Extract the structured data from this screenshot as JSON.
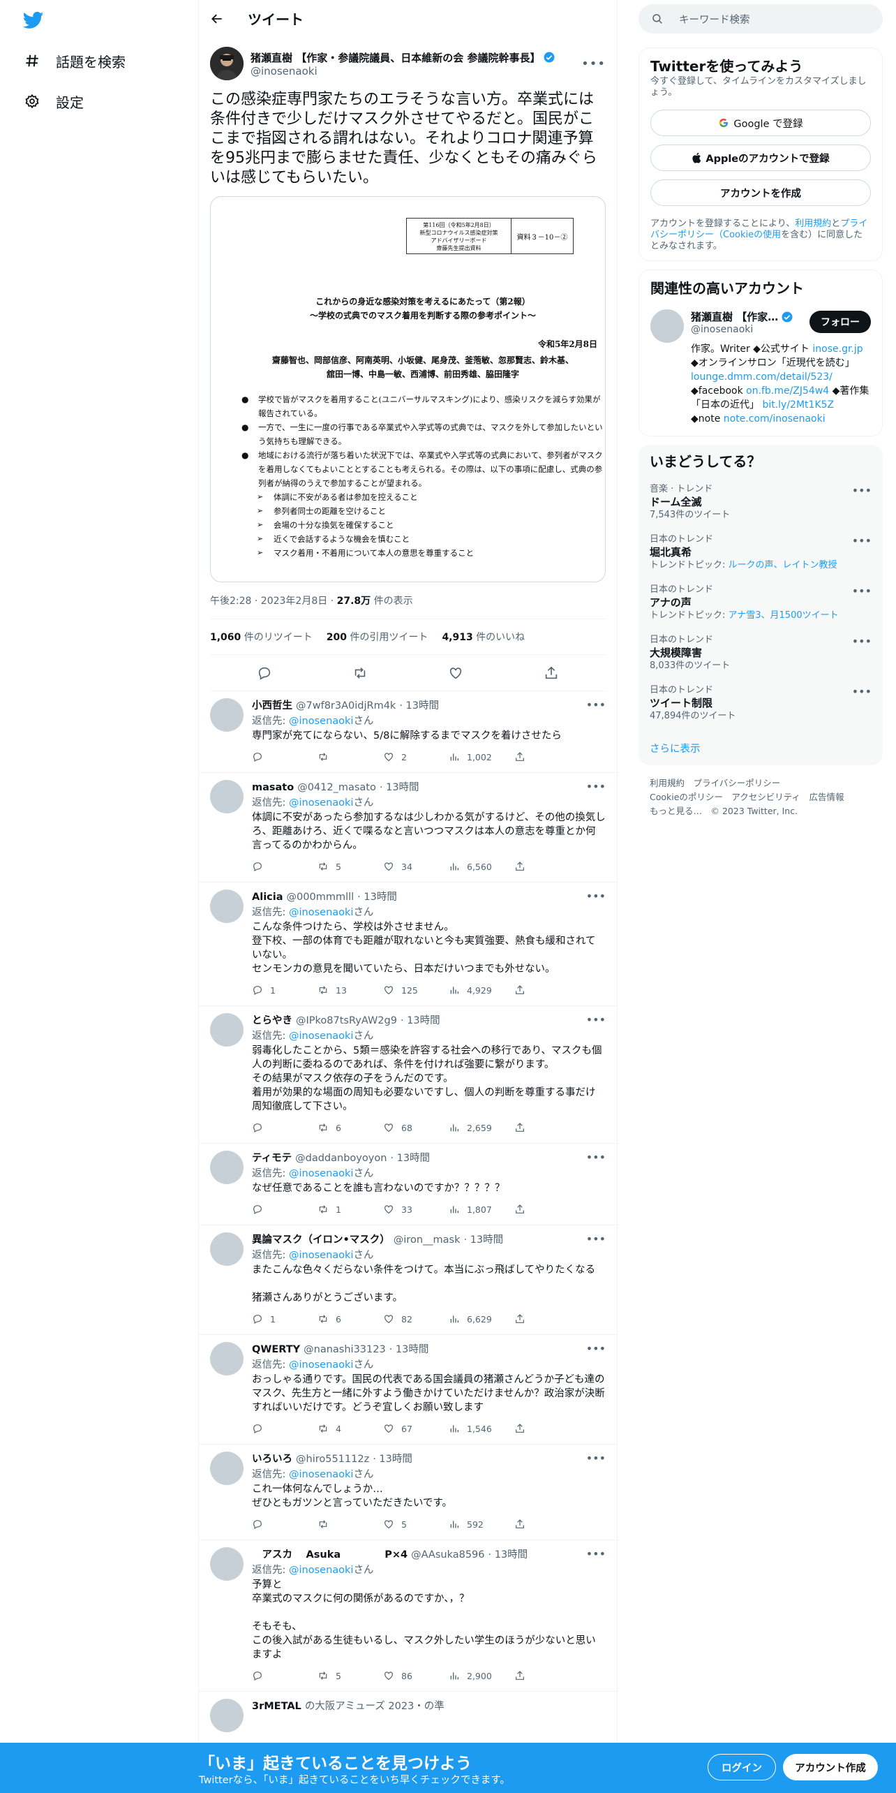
{
  "nav": {
    "items": [
      {
        "label": "話題を検索",
        "icon": "hashtag-icon"
      },
      {
        "label": "設定",
        "icon": "gear-icon"
      }
    ]
  },
  "header": {
    "title": "ツイート"
  },
  "tweet": {
    "name": "猪瀬直樹 【作家・参議院議員、日本維新の会 参議院幹事長】",
    "handle": "@inosenaoki",
    "text": "この感染症専門家たちのエラそうな言い方。卒業式には条件付きで少しだけマスク外させてやるだと。国民がここまで指図される謂れはない。それよりコロナ関連予算を95兆円まで膨らませた責任、少なくともその痛みぐらいは感じてもらいたい。",
    "doc": {
      "box_left": "第116回（令和5年2月8日）\n新型コロナウイルス感染症対策\nアドバイザリーボード\n齋藤先生提出資料",
      "box_right": "資料３－10－②",
      "title": "これからの身近な感染対策を考えるにあたって（第2報）\n〜学校の式典でのマスク着用を判断する際の参考ポイント〜",
      "date": "令和5年2月8日",
      "authors": "齋藤智也、岡部信彦、阿南英明、小坂健、尾身茂、釜萢敏、忽那賢志、鈴木基、\n舘田一博、中島一敏、西浦博、前田秀雄、脇田隆字",
      "bullets": [
        "学校で皆がマスクを着用すること(ユニバーサルマスキング)により、感染リスクを減らす効果が報告されている。",
        "一方で、一生に一度の行事である卒業式や入学式等の式典では、マスクを外して参加したいという気持ちも理解できる。",
        "地域における流行が落ち着いた状況下では、卒業式や入学式等の式典において、参列者がマスクを着用しなくてもよいこととすることも考えられる。その際は、以下の事項に配慮し、式典の参列者が納得のうえで参加することが望まれる。"
      ],
      "arrows": [
        "体調に不安がある者は参加を控えること",
        "参列者同士の距離を空けること",
        "会場の十分な換気を確保すること",
        "近くで会話するような機会を慎むこと",
        "マスク着用・不着用について本人の意思を尊重すること"
      ]
    },
    "time": "午後2:28 · 2023年2月8日 · ",
    "views": "27.8万",
    "views_label": " 件の表示",
    "retweets": "1,060",
    "retweets_label": " 件のリツイート",
    "quotes": "200",
    "quotes_label": " 件の引用ツイート",
    "likes": "4,913",
    "likes_label": " 件のいいね"
  },
  "replies": [
    {
      "name": "小西哲生",
      "handle": "@7wf8r3A0idjRm4k",
      "time": "· 13時間",
      "to": "返信先: ",
      "to_handle": "@inosenaoki",
      "to_suffix": "さん",
      "text": "専門家が充てにならない、5/8に解除するまでマスクを着けさせたら",
      "reply": "",
      "rt": "",
      "like": "2",
      "views": "1,002"
    },
    {
      "name": "masato",
      "handle": "@0412_masato",
      "time": "· 13時間",
      "to": "返信先: ",
      "to_handle": "@inosenaoki",
      "to_suffix": "さん",
      "text": "体調に不安があったら参加するなは少しわかる気がするけど、その他の換気しろ、距離あけろ、近くで喋るなと言いつつマスクは本人の意志を尊重とか何言ってるのかわからん。",
      "reply": "",
      "rt": "5",
      "like": "34",
      "views": "6,560"
    },
    {
      "name": "Alicia",
      "handle": "@000mmmlll",
      "time": "· 13時間",
      "to": "返信先: ",
      "to_handle": "@inosenaoki",
      "to_suffix": "さん",
      "text": "こんな条件つけたら、学校は外させません。\n登下校、一部の体育でも距離が取れないと今も実質強要、熱食も緩和されていない。\nセンモンカの意見を聞いていたら、日本だけいつまでも外せない。",
      "reply": "1",
      "rt": "13",
      "like": "125",
      "views": "4,929"
    },
    {
      "name": "とらやき",
      "handle": "@IPko87tsRyAW2g9",
      "time": "· 13時間",
      "to": "返信先: ",
      "to_handle": "@inosenaoki",
      "to_suffix": "さん",
      "text": "弱毒化したことから、5類＝感染を許容する社会への移行であり、マスクも個人の判断に委ねるのであれば、条件を付ければ強要に繋がります。\nその結果がマスク依存の子をうんだのです。\n着用が効果的な場面の周知も必要ないですし、個人の判断を尊重する事だけ周知徹底して下さい。",
      "reply": "",
      "rt": "6",
      "like": "68",
      "views": "2,659"
    },
    {
      "name": "ティモテ",
      "handle": "@daddanboyoyon",
      "time": "· 13時間",
      "to": "返信先: ",
      "to_handle": "@inosenaoki",
      "to_suffix": "さん",
      "text": "なぜ任意であることを誰も言わないのですか？？？？？",
      "reply": "",
      "rt": "1",
      "like": "33",
      "views": "1,807"
    },
    {
      "name": "異論マスク（イロン•マスク）",
      "handle": "@iron__mask",
      "time": "· 13時間",
      "to": "返信先: ",
      "to_handle": "@inosenaoki",
      "to_suffix": "さん",
      "text": "またこんな色々くだらない条件をつけて。本当にぶっ飛ばしてやりたくなる\n\n猪瀬さんありがとうございます。",
      "reply": "1",
      "rt": "6",
      "like": "82",
      "views": "6,629"
    },
    {
      "name": "QWERTY",
      "handle": "@nanashi33123",
      "time": "· 13時間",
      "to": "返信先: ",
      "to_handle": "@inosenaoki",
      "to_suffix": "さん",
      "text": "おっしゃる通りです。国民の代表である国会議員の猪瀬さんどうか子ども達のマスク、先生方と一緒に外すよう働きかけていただけませんか？政治家が決断すればいいだけです。どうぞ宜しくお願い致します",
      "reply": "",
      "rt": "4",
      "like": "67",
      "views": "1,546"
    },
    {
      "name": "いろいろ",
      "handle": "@hiro551112z",
      "time": "· 13時間",
      "to": "返信先: ",
      "to_handle": "@inosenaoki",
      "to_suffix": "さん",
      "text": "これ一体何なんでしょうか…\nぜひともガツンと言っていただきたいです。",
      "reply": "",
      "rt": "",
      "like": "5",
      "views": "592"
    },
    {
      "name": "　アスカ　 Asuka　　　　 P×4",
      "handle": "@AAsuka8596",
      "time": "· 13時間",
      "to": "返信先: ",
      "to_handle": "@inosenaoki",
      "to_suffix": "さん",
      "text": "予算と\n卒業式のマスクに何の関係があるのですか、，？\n\nそもそも、\nこの後入試がある生徒もいるし、マスク外したい学生のほうが少ないと思いますよ",
      "reply": "",
      "rt": "5",
      "like": "86",
      "views": "2,900"
    }
  ],
  "right": {
    "search_placeholder": "キーワード検索",
    "signup": {
      "title": "Twitterを使ってみよう",
      "sub": "今すぐ登録して、タイムラインをカスタマイズしましょう。",
      "google": "Google で登録",
      "apple": "Appleのアカウントで登録",
      "create": "アカウントを作成",
      "terms": "アカウントを登録することにより、",
      "terms_link1": "利用規約",
      "terms_mid": "と",
      "terms_link2": "プライバシーポリシー（Cookieの使用",
      "terms_end": "を含む）に同意したとみなされます。"
    },
    "related": {
      "title": "関連性の高いアカウント",
      "name": "猪瀬直樹 【作家…",
      "handle": "@inosenaoki",
      "follow": "フォロー",
      "bio1": "作家。Writer ◆公式サイト ",
      "link1": "inose.gr.jp",
      "bio2": "◆オンラインサロン「近現代を読む」",
      "link2": "lounge.dmm.com/detail/523/",
      "bio3": "◆facebook ",
      "link3": "on.fb.me/ZJ54w4",
      "bio4": " ◆著作集「日本の近代」 ",
      "link4": "bit.ly/2Mt1K5Z",
      "bio5": "◆note ",
      "link5": "note.com/inosenaoki"
    },
    "trends": {
      "title": "いまどうしてる？",
      "items": [
        {
          "cat": "音楽 · トレンド",
          "t": "ドーム全滅",
          "c": "7,543件のツイート",
          "topic": "",
          "topic_links": ""
        },
        {
          "cat": "日本のトレンド",
          "t": "堀北真希",
          "c": "",
          "topic": "トレンドトピック: ",
          "topic_links": "ルークの声、レイトン教授"
        },
        {
          "cat": "日本のトレンド",
          "t": "アナの声",
          "c": "",
          "topic": "トレンドトピック: ",
          "topic_links": "アナ雪3、月1500ツイート"
        },
        {
          "cat": "日本のトレンド",
          "t": "大規模障害",
          "c": "8,033件のツイート",
          "topic": "",
          "topic_links": ""
        },
        {
          "cat": "日本のトレンド",
          "t": "ツイート制限",
          "c": "47,894件のツイート",
          "topic": "",
          "topic_links": ""
        }
      ],
      "more": "さらに表示"
    },
    "footer": {
      "l1": "利用規約　プライバシーポリシー",
      "l2": "Cookieのポリシー　アクセシビリティ　広告情報",
      "l3": "もっと見る…　© 2023 Twitter, Inc."
    }
  },
  "bottom": {
    "title": "「いま」起きていることを見つけよう",
    "sub": "Twitterなら、「いま」起きていることをいち早くチェックできます。",
    "login": "ログイン",
    "signup": "アカウント作成"
  },
  "partial": {
    "name": "3rMETAL",
    "text": "の大阪アミューズ 2023・の準"
  },
  "colors": {
    "accent": "#1d9bf0",
    "text": "#0f1419",
    "muted": "#536471"
  }
}
